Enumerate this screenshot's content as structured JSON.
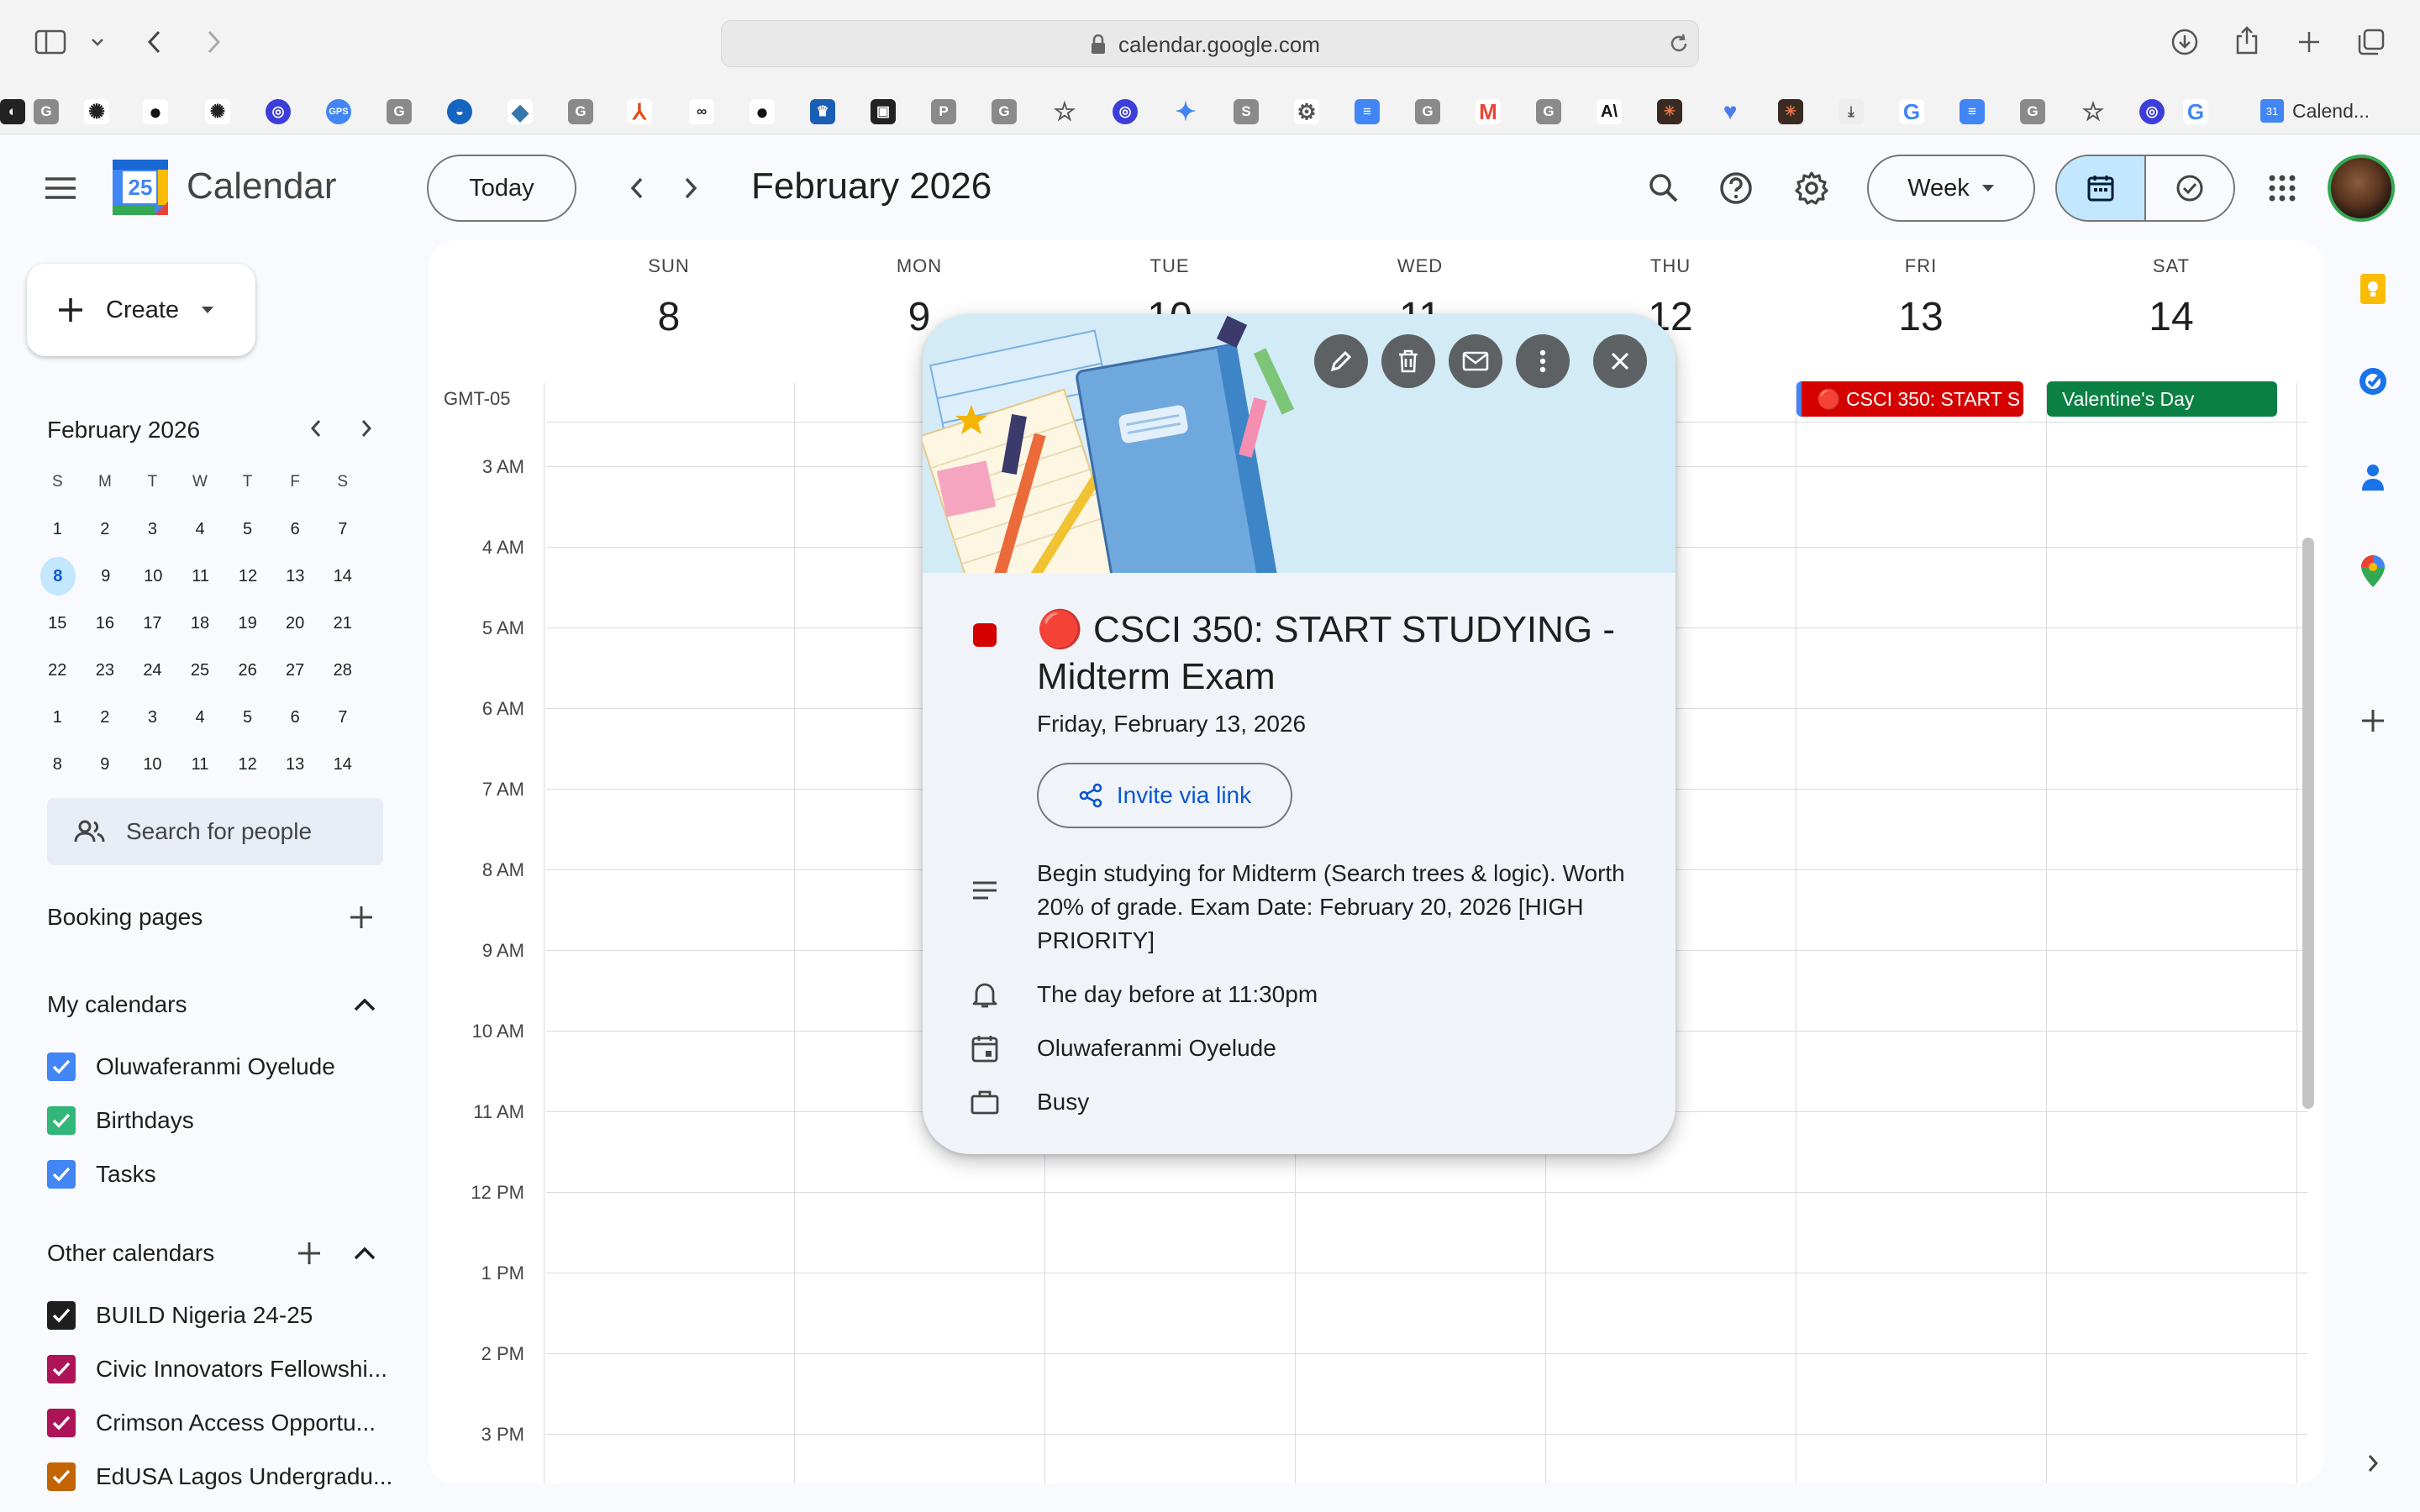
{
  "browser": {
    "url": "calendar.google.com",
    "active_tab_label": "Calend..."
  },
  "header": {
    "app_title": "Calendar",
    "logo_day": "25",
    "today_label": "Today",
    "month_title": "February 2026",
    "view_label": "Week"
  },
  "sidebar": {
    "create_label": "Create",
    "mini_calendar": {
      "title": "February 2026",
      "weekdays": [
        "S",
        "M",
        "T",
        "W",
        "T",
        "F",
        "S"
      ],
      "weeks": [
        [
          "1",
          "2",
          "3",
          "4",
          "5",
          "6",
          "7"
        ],
        [
          "8",
          "9",
          "10",
          "11",
          "12",
          "13",
          "14"
        ],
        [
          "15",
          "16",
          "17",
          "18",
          "19",
          "20",
          "21"
        ],
        [
          "22",
          "23",
          "24",
          "25",
          "26",
          "27",
          "28"
        ],
        [
          "1",
          "2",
          "3",
          "4",
          "5",
          "6",
          "7"
        ],
        [
          "8",
          "9",
          "10",
          "11",
          "12",
          "13",
          "14"
        ]
      ],
      "selected": "8"
    },
    "search_people_placeholder": "Search for people",
    "booking_pages_label": "Booking pages",
    "my_calendars_label": "My calendars",
    "my_calendars": [
      {
        "name": "Oluwaferanmi Oyelude",
        "color": "#4285f4"
      },
      {
        "name": "Birthdays",
        "color": "#33b679"
      },
      {
        "name": "Tasks",
        "color": "#4285f4"
      }
    ],
    "other_calendars_label": "Other calendars",
    "other_calendars": [
      {
        "name": "BUILD Nigeria 24-25",
        "color": "#1f1f1f"
      },
      {
        "name": "Civic Innovators Fellowshi...",
        "color": "#ad1457"
      },
      {
        "name": "Crimson Access Opportu...",
        "color": "#ad1457"
      },
      {
        "name": "EdUSA Lagos Undergradu...",
        "color": "#c26401"
      }
    ]
  },
  "week": {
    "timezone": "GMT-05",
    "days": [
      {
        "name": "SUN",
        "date": "8"
      },
      {
        "name": "MON",
        "date": "9"
      },
      {
        "name": "TUE",
        "date": "10"
      },
      {
        "name": "WED",
        "date": "11"
      },
      {
        "name": "THU",
        "date": "12"
      },
      {
        "name": "FRI",
        "date": "13"
      },
      {
        "name": "SAT",
        "date": "14"
      }
    ],
    "hours": [
      "3 AM",
      "4 AM",
      "5 AM",
      "6 AM",
      "7 AM",
      "8 AM",
      "9 AM",
      "10 AM",
      "11 AM",
      "12 PM",
      "1 PM",
      "2 PM",
      "3 PM"
    ],
    "allday_events": [
      {
        "title": "🔴 CSCI 350: START STUDYING - Midterm Exam",
        "display": "🔴 CSCI 350: START S",
        "color": "#d50000"
      },
      {
        "title": "Valentine's Day",
        "display": "Valentine's Day",
        "color": "#0b8043"
      }
    ]
  },
  "event_popover": {
    "title": "🔴 CSCI 350: START STUDYING - Midterm Exam",
    "date": "Friday, February 13, 2026",
    "invite_label": "Invite via link",
    "description": "Begin studying for Midterm (Search trees & logic). Worth 20% of grade. Exam Date: February 20, 2026 [HIGH PRIORITY]",
    "reminder": "The day before at 11:30pm",
    "calendar": "Oluwaferanmi Oyelude",
    "availability": "Busy",
    "color": "#d50000"
  },
  "colors": {
    "accent": "#0b57d0",
    "selected_bg": "#c2e7ff",
    "grid_line": "#dadce0"
  }
}
